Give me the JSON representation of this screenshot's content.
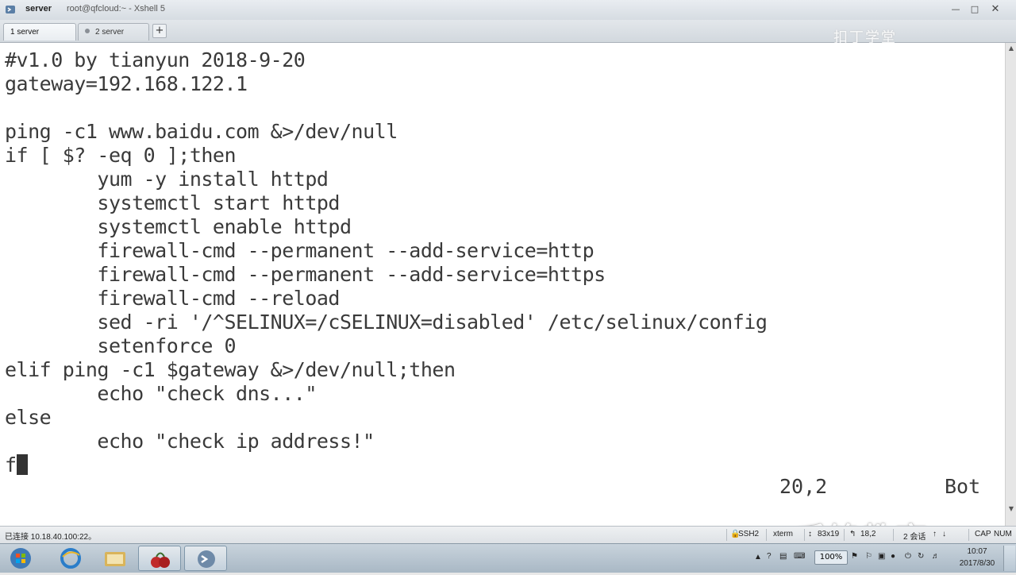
{
  "window": {
    "title": "server",
    "subtitle": "root@qfcloud:~ - Xshell 5"
  },
  "tabs": [
    {
      "label": "1 server",
      "active": true
    },
    {
      "label": "2 server",
      "active": false
    }
  ],
  "watermark_top": "扣丁学堂",
  "terminal": {
    "lines": [
      "#v1.0 by tianyun 2018-9-20",
      "gateway=192.168.122.1",
      "",
      "ping -c1 www.baidu.com &>/dev/null",
      "if [ $? -eq 0 ];then",
      "        yum -y install httpd",
      "        systemctl start httpd",
      "        systemctl enable httpd",
      "        firewall-cmd --permanent --add-service=http",
      "        firewall-cmd --permanent --add-service=https",
      "        firewall-cmd --reload",
      "        sed -ri '/^SELINUX=/cSELINUX=disabled' /etc/selinux/config",
      "        setenforce 0",
      "elif ping -c1 $gateway &>/dev/null;then",
      "        echo \"check dns...\"",
      "else",
      "        echo \"check ip address!\"",
      "f"
    ],
    "ruler": "20,2",
    "position": "Bot",
    "brand_watermark": "千锋教育"
  },
  "statusbar": {
    "connection": "已连接 10.18.40.100:22。",
    "protocol": "SSH2",
    "terminal_type": "xterm",
    "size": "83x19",
    "cursor": "18,2",
    "sessions": "2 会话",
    "cap": "CAP",
    "num": "NUM"
  },
  "taskbar": {
    "zoom": "100%",
    "time": "10:07",
    "date": "2017/8/30"
  }
}
